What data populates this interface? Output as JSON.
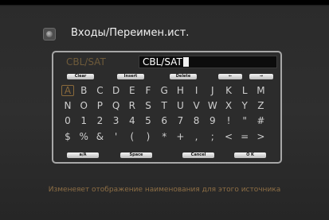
{
  "header": {
    "title": "Входы/Переимен.ист.",
    "icon": "input-source-icon"
  },
  "editor": {
    "source_label": "CBL/SAT",
    "name_value": "CBL/SAT"
  },
  "function_row_top": [
    "Clear",
    "Insert",
    "Delete",
    "←",
    "→"
  ],
  "keyboard_rows": [
    [
      "A",
      "B",
      "C",
      "D",
      "E",
      "F",
      "G",
      "H",
      "I",
      "J",
      "K",
      "L",
      "M"
    ],
    [
      "N",
      "O",
      "P",
      "Q",
      "R",
      "S",
      "T",
      "U",
      "V",
      "W",
      "X",
      "Y",
      "Z"
    ],
    [
      "0",
      "1",
      "2",
      "3",
      "4",
      "5",
      "6",
      "7",
      "8",
      "9",
      "!",
      "\"",
      "#"
    ],
    [
      "$",
      "%",
      "&",
      "'",
      "(",
      ")",
      "*",
      "+",
      ",",
      ";",
      "<",
      "=",
      ">"
    ]
  ],
  "selected_key": "A",
  "function_row_bottom": [
    "a/A",
    "Space",
    "Cancel",
    "O K"
  ],
  "help_text": "Изменеяет отображение наименования для этого источника",
  "colors": {
    "accent": "#8a6a3b",
    "panel_border": "#a7a7a7",
    "background": "#2c2c2c"
  }
}
